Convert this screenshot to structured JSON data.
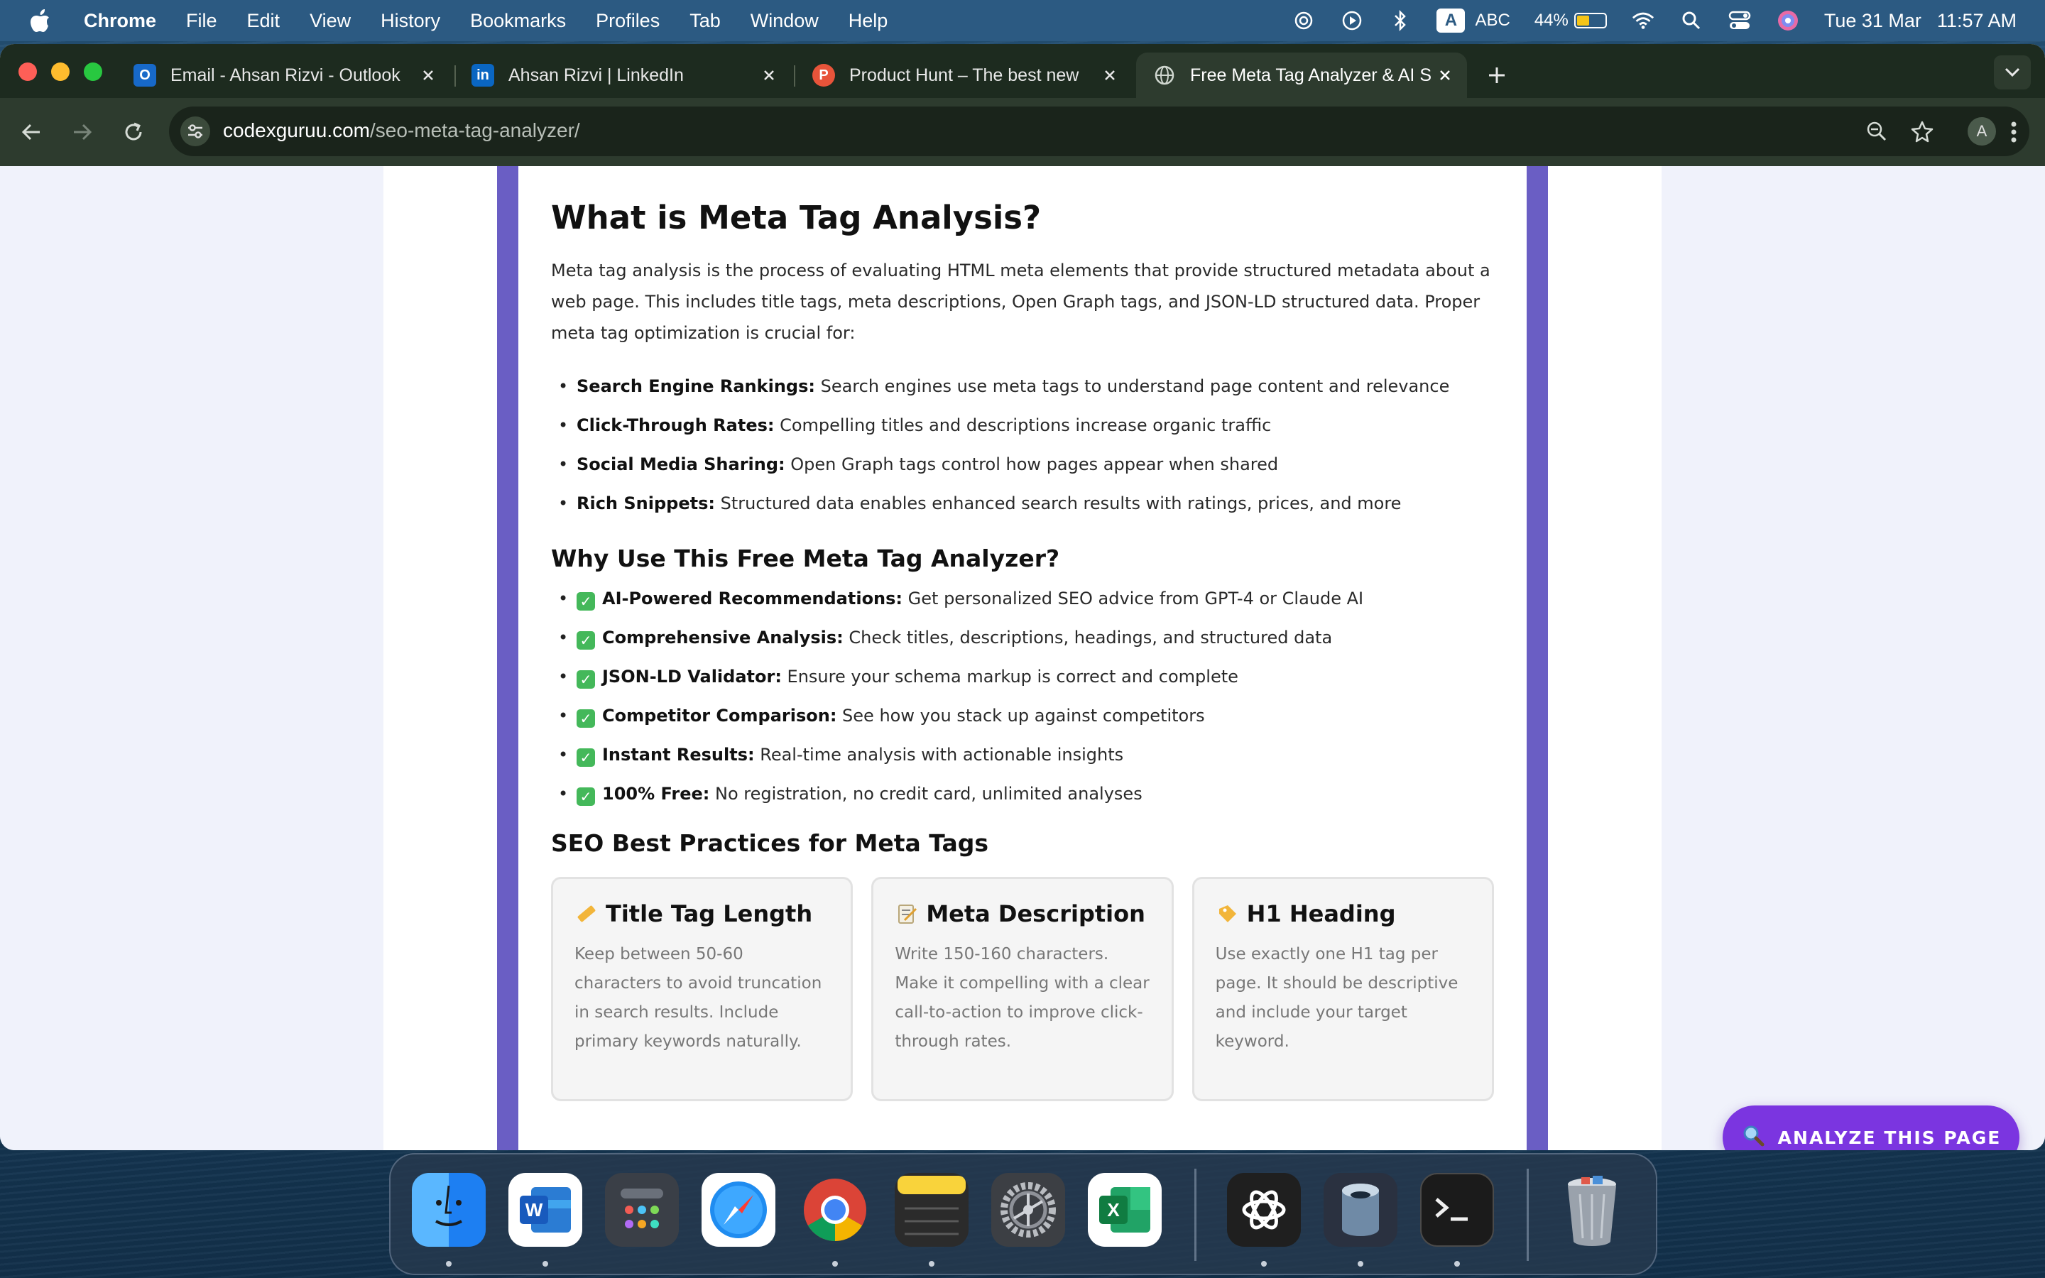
{
  "menubar": {
    "app_name": "Chrome",
    "items": [
      "File",
      "Edit",
      "View",
      "History",
      "Bookmarks",
      "Profiles",
      "Tab",
      "Window",
      "Help"
    ],
    "input_source": "ABC",
    "input_badge": "A",
    "battery_percent": "44%",
    "battery_level": 0.44,
    "date": "Tue 31 Mar",
    "time": "11:57 AM"
  },
  "tabs": [
    {
      "title": "Email - Ahsan Rizvi - Outlook",
      "icon": "outlook-icon",
      "active": false
    },
    {
      "title": "Ahsan Rizvi | LinkedIn",
      "icon": "linkedin-icon",
      "active": false
    },
    {
      "title": "Product Hunt – The best new",
      "icon": "producthunt-icon",
      "active": false
    },
    {
      "title": "Free Meta Tag Analyzer & AI S",
      "icon": "globe-icon",
      "active": true
    }
  ],
  "toolbar": {
    "url_host": "codexguruu.com",
    "url_path": "/seo-meta-tag-analyzer/",
    "profile_initial": "A"
  },
  "content": {
    "heading": "What is Meta Tag Analysis?",
    "intro": "Meta tag analysis is the process of evaluating HTML meta elements that provide structured metadata about a web page. This includes title tags, meta descriptions, Open Graph tags, and JSON-LD structured data. Proper meta tag optimization is crucial for:",
    "importance": [
      {
        "label": "Search Engine Rankings:",
        "text": " Search engines use meta tags to understand page content and relevance"
      },
      {
        "label": "Click-Through Rates:",
        "text": " Compelling titles and descriptions increase organic traffic"
      },
      {
        "label": "Social Media Sharing:",
        "text": " Open Graph tags control how pages appear when shared"
      },
      {
        "label": "Rich Snippets:",
        "text": " Structured data enables enhanced search results with ratings, prices, and more"
      }
    ],
    "why_heading": "Why Use This Free Meta Tag Analyzer?",
    "why": [
      {
        "label": "AI-Powered Recommendations:",
        "text": " Get personalized SEO advice from GPT-4 or Claude AI"
      },
      {
        "label": "Comprehensive Analysis:",
        "text": " Check titles, descriptions, headings, and structured data"
      },
      {
        "label": "JSON-LD Validator:",
        "text": " Ensure your schema markup is correct and complete"
      },
      {
        "label": "Competitor Comparison:",
        "text": " See how you stack up against competitors"
      },
      {
        "label": "Instant Results:",
        "text": " Real-time analysis with actionable insights"
      },
      {
        "label": "100% Free:",
        "text": " No registration, no credit card, unlimited analyses"
      }
    ],
    "practices_heading": "SEO Best Practices for Meta Tags",
    "cards": [
      {
        "emoji": "ruler-icon",
        "title": "Title Tag Length",
        "text": "Keep between 50-60 characters to avoid truncation in search results. Include primary keywords naturally."
      },
      {
        "emoji": "memo-icon",
        "title": "Meta Description",
        "text": "Write 150-160 characters. Make it compelling with a clear call-to-action to improve click-through rates."
      },
      {
        "emoji": "label-icon",
        "title": "H1 Heading",
        "text": "Use exactly one H1 tag per page. It should be descriptive and include your target keyword."
      }
    ]
  },
  "cta": {
    "label": "ANALYZE THIS PAGE",
    "icon": "magnifier-icon"
  },
  "dock": {
    "apps": [
      "Finder",
      "Microsoft Word",
      "Launchpad",
      "Safari",
      "Google Chrome",
      "Notes",
      "System Settings",
      "Microsoft Excel",
      "ChatGPT",
      "Sequel",
      "Terminal",
      "Trash"
    ]
  },
  "colors": {
    "accent_purple": "#7b35e0",
    "band_purple": "#6a5ec4",
    "chrome_dark": "#2d3b2e",
    "menubar_blue": "#2c5a82"
  }
}
